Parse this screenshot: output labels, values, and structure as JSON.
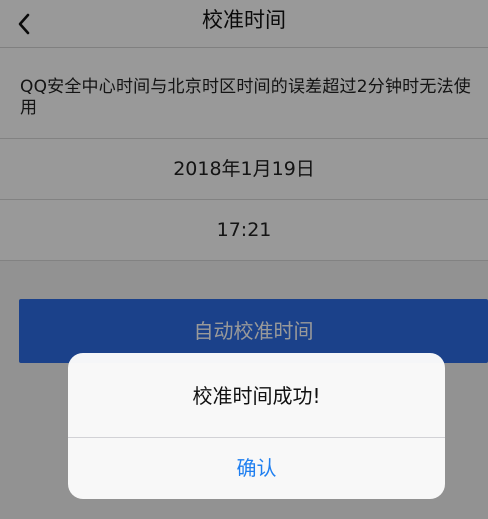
{
  "header": {
    "back_icon": "chevron-left-icon",
    "title": "校准时间"
  },
  "notice": {
    "text": "QQ安全中心时间与北京时区时间的误差超过2分钟时无法使用"
  },
  "date": {
    "value": "2018年1月19日"
  },
  "time": {
    "value": "17:21"
  },
  "actions": {
    "auto_calibrate_label": "自动校准时间"
  },
  "dialog": {
    "message": "校准时间成功!",
    "confirm_label": "确认"
  },
  "colors": {
    "primary": "#2d6de6",
    "link": "#1f7ff0",
    "overlay": "rgba(0,0,0,0.40)"
  }
}
